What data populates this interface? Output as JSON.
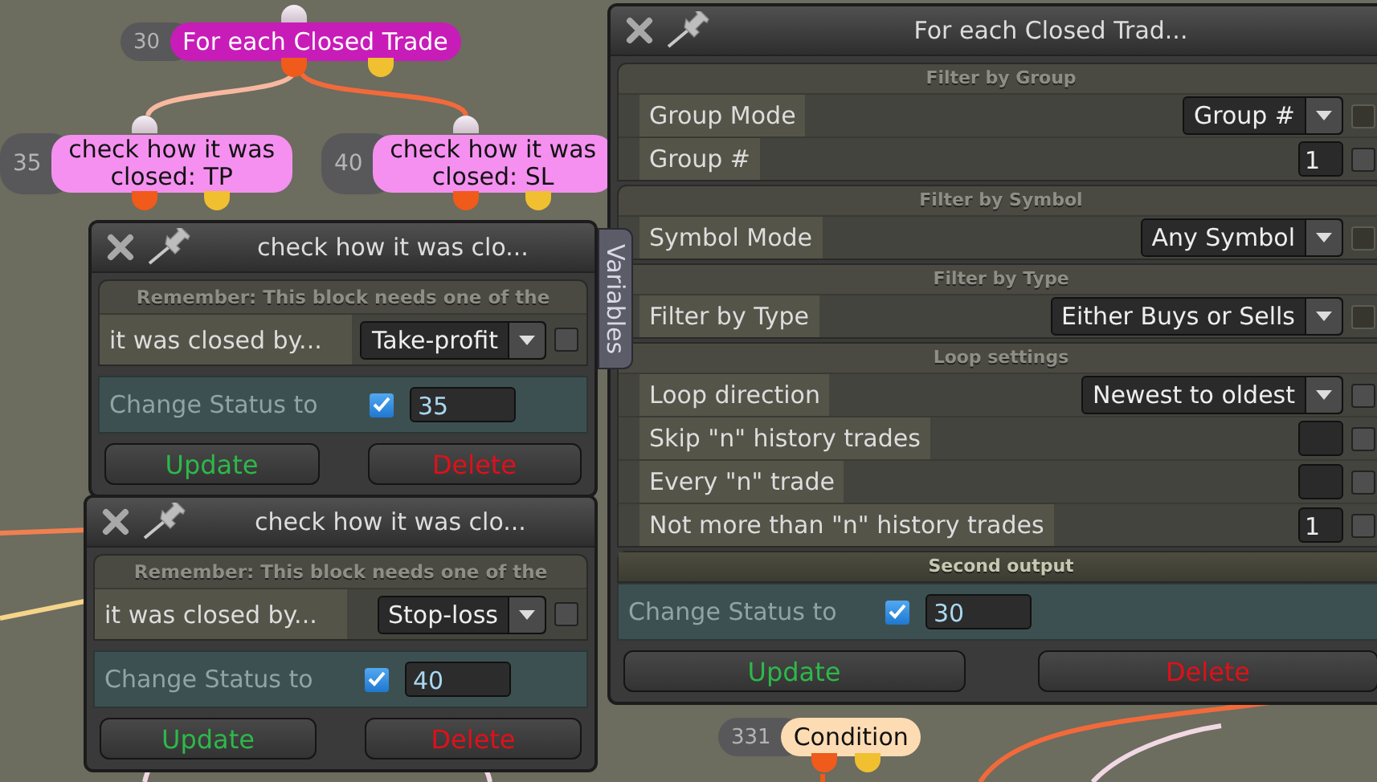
{
  "nodes": [
    {
      "number": "30",
      "label": "For each Closed Trade",
      "color": "#c81cb8"
    },
    {
      "number": "35",
      "label": "check how it was closed: TP",
      "color": "#f590f0"
    },
    {
      "number": "40",
      "label": "check how it was closed: SL",
      "color": "#f590f0"
    },
    {
      "number": "331",
      "label": "Condition",
      "color": "#fddcb4"
    }
  ],
  "windows": [
    {
      "title": "check how it was clo...",
      "side_tab": "Variables",
      "sections": [
        {
          "title": "Remember: This block needs one of the",
          "rows": [
            {
              "kind": "select",
              "label": "it was closed by...",
              "value": "Take-profit",
              "checked": false,
              "checkbox_disabled": false
            }
          ]
        }
      ],
      "status": {
        "label": "Change Status to",
        "checked": true,
        "value": "35"
      },
      "buttons": [
        {
          "label": "Update",
          "kind": "update"
        },
        {
          "label": "Delete",
          "kind": "delete"
        }
      ]
    },
    {
      "title": "check how it was clo...",
      "sections": [
        {
          "title": "Remember: This block needs one of the",
          "rows": [
            {
              "kind": "select",
              "label": "it was closed by...",
              "value": "Stop-loss",
              "checked": false,
              "checkbox_disabled": false
            }
          ]
        }
      ],
      "status": {
        "label": "Change Status to",
        "checked": true,
        "value": "40"
      },
      "buttons": [
        {
          "label": "Update",
          "kind": "update"
        },
        {
          "label": "Delete",
          "kind": "delete"
        }
      ]
    },
    {
      "title": "For each Closed Trad...",
      "sections": [
        {
          "title": "Filter by Group",
          "highlight": false,
          "rows": [
            {
              "kind": "select",
              "label": "Group Mode",
              "value": "Group #",
              "checked": false,
              "checkbox_disabled": true
            },
            {
              "kind": "number",
              "label": "Group #",
              "value": "1",
              "checked": false,
              "checkbox_disabled": false
            }
          ]
        },
        {
          "title": "Filter by Symbol",
          "highlight": false,
          "rows": [
            {
              "kind": "select",
              "label": "Symbol Mode",
              "value": "Any Symbol",
              "checked": false,
              "checkbox_disabled": true
            }
          ]
        },
        {
          "title": "Filter by Type",
          "highlight": false,
          "rows": [
            {
              "kind": "select",
              "label": "Filter by Type",
              "value": "Either Buys or Sells",
              "checked": false,
              "checkbox_disabled": true
            }
          ]
        },
        {
          "title": "Loop settings",
          "highlight": false,
          "rows": [
            {
              "kind": "select",
              "label": "Loop direction",
              "value": "Newest to oldest",
              "checked": false,
              "checkbox_disabled": false
            },
            {
              "kind": "number",
              "label": "Skip \"n\" history trades",
              "checked": false,
              "checkbox_disabled": false
            },
            {
              "kind": "number",
              "label": "Every \"n\" trade",
              "checked": false,
              "checkbox_disabled": false
            },
            {
              "kind": "number",
              "label": "Not more than \"n\" history trades",
              "value": "1",
              "checked": false,
              "checkbox_disabled": false
            }
          ]
        },
        {
          "title": "Second output",
          "highlight": true
        }
      ],
      "status": {
        "label": "Change Status to",
        "checked": true,
        "value": "30"
      },
      "buttons": [
        {
          "label": "Update",
          "kind": "update"
        },
        {
          "label": "Delete",
          "kind": "delete"
        }
      ]
    }
  ]
}
